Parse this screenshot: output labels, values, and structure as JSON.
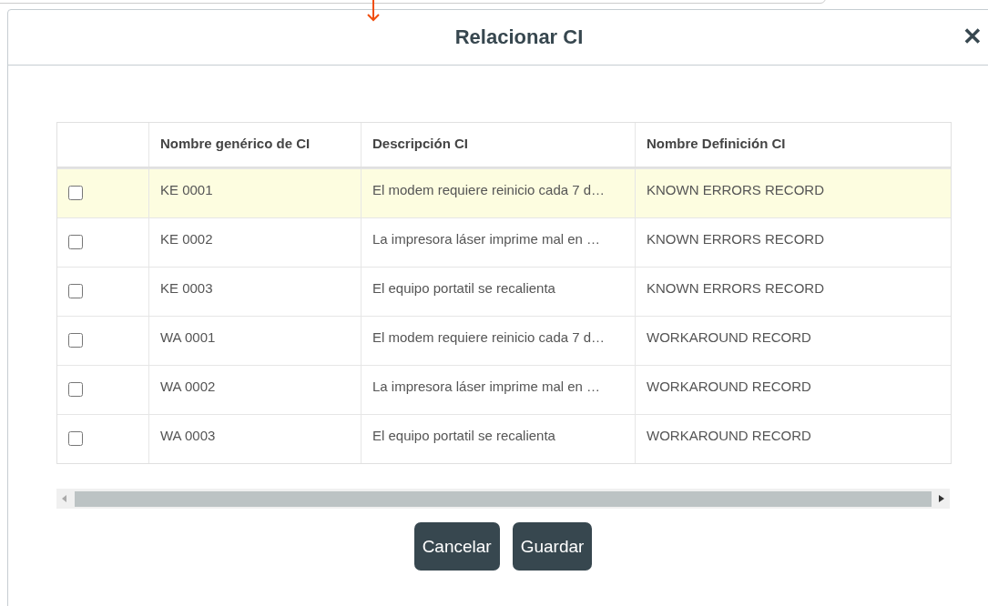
{
  "dialog": {
    "title": "Relacionar CI",
    "close": "✕"
  },
  "table": {
    "columns": [
      "Nombre genérico de CI",
      "Descripción CI",
      "Nombre Definición CI"
    ],
    "rows": [
      {
        "checked": false,
        "highlighted": true,
        "cells": [
          "KE 0001",
          "El modem requiere reinicio cada 7 d…",
          "KNOWN ERRORS RECORD"
        ]
      },
      {
        "checked": false,
        "highlighted": false,
        "cells": [
          "KE 0002",
          "La impresora láser imprime mal en …",
          "KNOWN ERRORS RECORD"
        ]
      },
      {
        "checked": false,
        "highlighted": false,
        "cells": [
          "KE 0003",
          "El equipo portatil se recalienta",
          "KNOWN ERRORS RECORD"
        ]
      },
      {
        "checked": false,
        "highlighted": false,
        "cells": [
          "WA 0001",
          "El modem requiere reinicio cada 7 d…",
          "WORKAROUND RECORD"
        ]
      },
      {
        "checked": false,
        "highlighted": false,
        "cells": [
          "WA 0002",
          "La impresora láser imprime mal en …",
          "WORKAROUND RECORD"
        ]
      },
      {
        "checked": false,
        "highlighted": false,
        "cells": [
          "WA 0003",
          "El equipo portatil se recalienta",
          "WORKAROUND RECORD"
        ]
      }
    ]
  },
  "buttons": [
    "Cancelar",
    "Guardar"
  ]
}
